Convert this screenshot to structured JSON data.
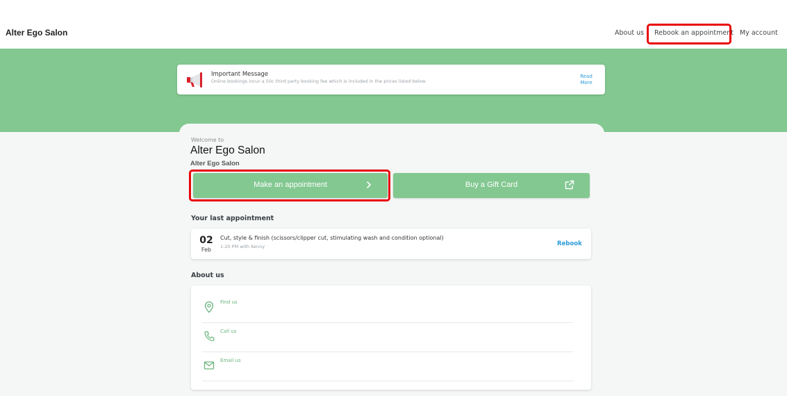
{
  "header": {
    "brand": "Alter Ego Salon",
    "nav": {
      "about": "About us",
      "rebook": "Rebook an appointment",
      "account": "My account"
    }
  },
  "message": {
    "icon": "megaphone-icon",
    "title": "Important Message",
    "text": "Online bookings incur a 50c third party booking fee which is included in the prices listed below",
    "read_more": "Read More"
  },
  "welcome": {
    "small": "Welcome to",
    "title": "Alter Ego Salon",
    "subtitle": "Alter Ego Salon"
  },
  "actions": {
    "make_appointment": "Make an appointment",
    "gift_card": "Buy a Gift Card"
  },
  "last_appointment": {
    "heading": "Your last appointment",
    "day": "02",
    "month": "Feb",
    "service": "Cut, style & finish (scissors/clipper cut, stimulating wash and condition optional)",
    "detail": "1:20 PM with Kenny",
    "rebook": "Rebook"
  },
  "about": {
    "heading": "About us",
    "find": "Find us",
    "call": "Call us",
    "email": "Email us"
  },
  "colors": {
    "accent_green": "#83c891",
    "link_blue": "#2a9bd6",
    "highlight_red": "#e8060a",
    "background": "#f5f7f6"
  }
}
